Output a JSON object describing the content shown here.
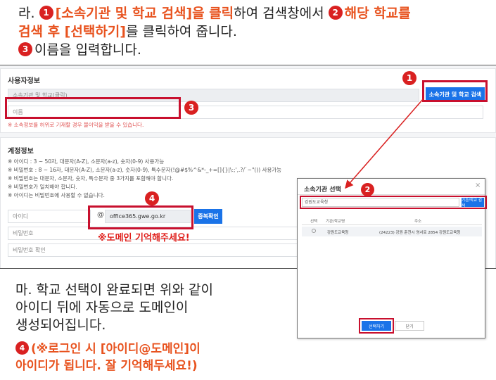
{
  "instruction_top": {
    "line1_prefix": "라.",
    "step1_num": "1",
    "step1_text": "[소속기관 및 학교 검색]을 클릭",
    "line1_mid": "하여 검색창에서",
    "step2_num": "2",
    "step2_text_a": "해당 학교를",
    "step2_text_b": "검색 후 [선택하기]",
    "line2_suffix": "를 클릭하여 줍니다.",
    "step3_num": "3",
    "step3_text": "이름을 입력합니다."
  },
  "form": {
    "section_user": "사용자정보",
    "org_field_placeholder": "소속기관 및 학교(클릭)",
    "name_field_placeholder": "이름",
    "org_warning": "※ 소속정보를 허위로 기재할 경우 불이익을 받을 수 있습니다.",
    "search_button": "소속기관 및 학교 검색",
    "section_account": "계정정보",
    "rules": [
      "※ 아이디 : 3 ~ 50자, 대문자(A-Z), 소문자(a-z), 숫자(0-9) 사용가능",
      "※ 비밀번호 : 8 ~ 16자, 대문자(A-Z), 소문자(a-z), 숫자(0-9), 특수문자(!@#$%^&*-_+=[]{}|\\:;',.?/`~\"()) 사용가능",
      "※ 비밀번호는 대문자, 소문자, 숫자, 특수문자 중 3가지를 포함해야 합니다.",
      "※ 비밀번호가 일치해야 합니다.",
      "※ 아이디는 비밀번호에 사용할 수 없습니다."
    ],
    "id_placeholder": "아이디",
    "at_sign": "@",
    "domain_value": "office365.gwe.go.kr",
    "dup_check_button": "중복확인",
    "password_placeholder": "비밀번호",
    "password_confirm_placeholder": "비밀번호 확인",
    "domain_note": "※도메인 기억해주세요!"
  },
  "badges": {
    "b1": "1",
    "b2": "2",
    "b3": "3",
    "b4": "4"
  },
  "modal": {
    "title": "소속기관 선택",
    "close": "×",
    "search_value": "강원도교육청",
    "search_button": "기관/학교 검색",
    "columns": [
      "선택",
      "기관/학교명",
      "주소"
    ],
    "row": {
      "name": "강원도교육청",
      "address": "(24223) 강원 춘천시 영서로 2854 강원도교육청"
    },
    "select_button": "선택하기",
    "close_button": "닫기"
  },
  "instruction_bottom": {
    "line1": "마. 학교 선택이 완료되면 위와 같이",
    "line2": "아이디 뒤에 자동으로 도메인이",
    "line3": "생성되어집니다.",
    "step4_num": "4",
    "step4_line1": "(※로그인 시 [아이디@도메인]이",
    "step4_line2": "아이디가 됩니다. 잘 기억해두세요!)"
  },
  "colors": {
    "accent_red": "#e8531f",
    "badge_red": "#d92121",
    "box_red": "#c8102e",
    "button_blue": "#1a73e8"
  }
}
